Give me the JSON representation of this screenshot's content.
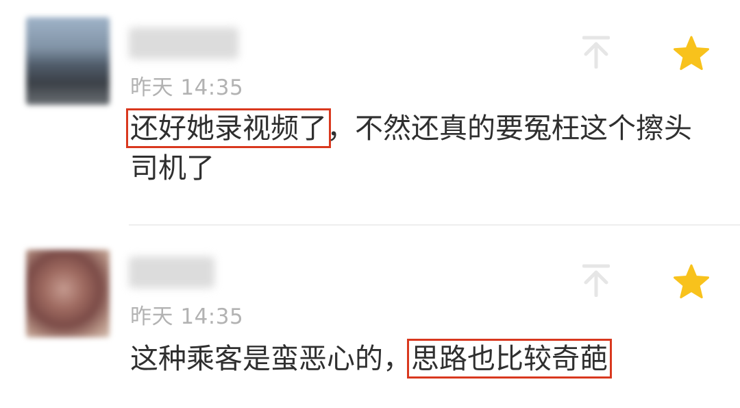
{
  "comments": [
    {
      "time": "昨天 14:35",
      "text_highlight": "还好她录视频了",
      "text_rest": "，不然还真的要冤枉这个擦头司机了",
      "star_color": "#f8c21c"
    },
    {
      "time": "昨天 14:35",
      "text_rest": "这种乘客是蛮恶心的，",
      "text_highlight": "思路也比较奇葩",
      "star_color": "#f8c21c"
    }
  ],
  "highlight_color": "#d9381e",
  "icons": [
    "pin-to-top-icon",
    "star-icon"
  ]
}
